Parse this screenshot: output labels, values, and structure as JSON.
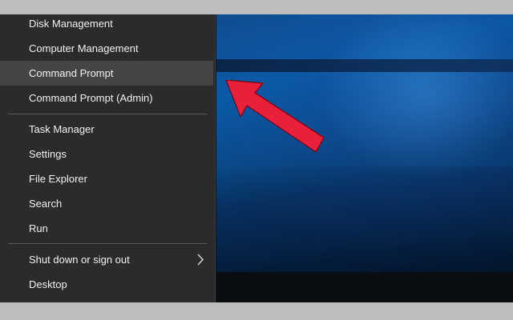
{
  "menu": {
    "items": [
      {
        "label": "Disk Management"
      },
      {
        "label": "Computer Management"
      },
      {
        "label": "Command Prompt"
      },
      {
        "label": "Command Prompt (Admin)"
      },
      {
        "label": "Task Manager"
      },
      {
        "label": "Settings"
      },
      {
        "label": "File Explorer"
      },
      {
        "label": "Search"
      },
      {
        "label": "Run"
      },
      {
        "label": "Shut down or sign out"
      },
      {
        "label": "Desktop"
      }
    ],
    "highlighted_index": 2
  },
  "icons": {
    "submenu": "chevron-right-icon",
    "annotation": "red-arrow-icon"
  },
  "colors": {
    "menu_bg": "#2b2b2b",
    "highlight_bg": "#454545",
    "text": "#f2f2f2",
    "separator": "#5a5a5a",
    "arrow": "#e8203a",
    "desktop_blue": "#0b5aa6"
  }
}
